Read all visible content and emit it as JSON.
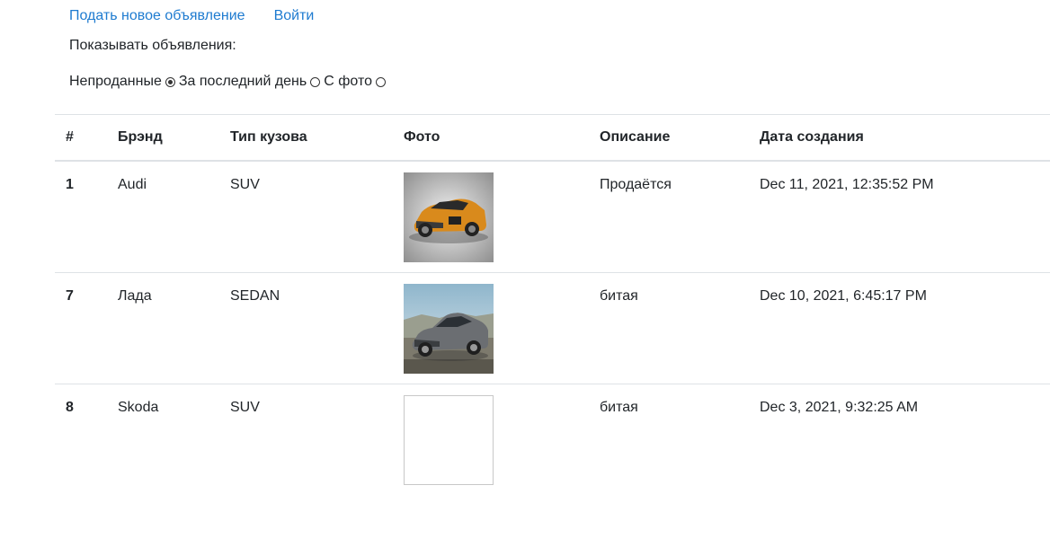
{
  "nav": {
    "new_ad": "Подать новое объявление",
    "login": "Войти"
  },
  "filters": {
    "label": "Показывать объявления:",
    "options": [
      {
        "label": "Непроданные",
        "checked": true
      },
      {
        "label": "За последний день",
        "checked": false
      },
      {
        "label": "С фото",
        "checked": false
      }
    ]
  },
  "table": {
    "headers": {
      "num": "#",
      "brand": "Брэнд",
      "body": "Тип кузова",
      "photo": "Фото",
      "desc": "Описание",
      "date": "Дата создания"
    },
    "rows": [
      {
        "num": "1",
        "brand": "Audi",
        "body": "SUV",
        "photo": "orange-suv",
        "desc": "Продаётся",
        "date": "Dec 11, 2021, 12:35:52 PM"
      },
      {
        "num": "7",
        "brand": "Лада",
        "body": "SEDAN",
        "photo": "grey-sedan",
        "desc": "битая",
        "date": "Dec 10, 2021, 6:45:17 PM"
      },
      {
        "num": "8",
        "brand": "Skoda",
        "body": "SUV",
        "photo": "broken-image",
        "desc": "битая",
        "date": "Dec 3, 2021, 9:32:25 AM"
      }
    ]
  },
  "colors": {
    "link": "#1e7bd0",
    "border": "#dee2e6",
    "car_orange": "#e08a1e",
    "car_grey": "#6b6e72"
  }
}
